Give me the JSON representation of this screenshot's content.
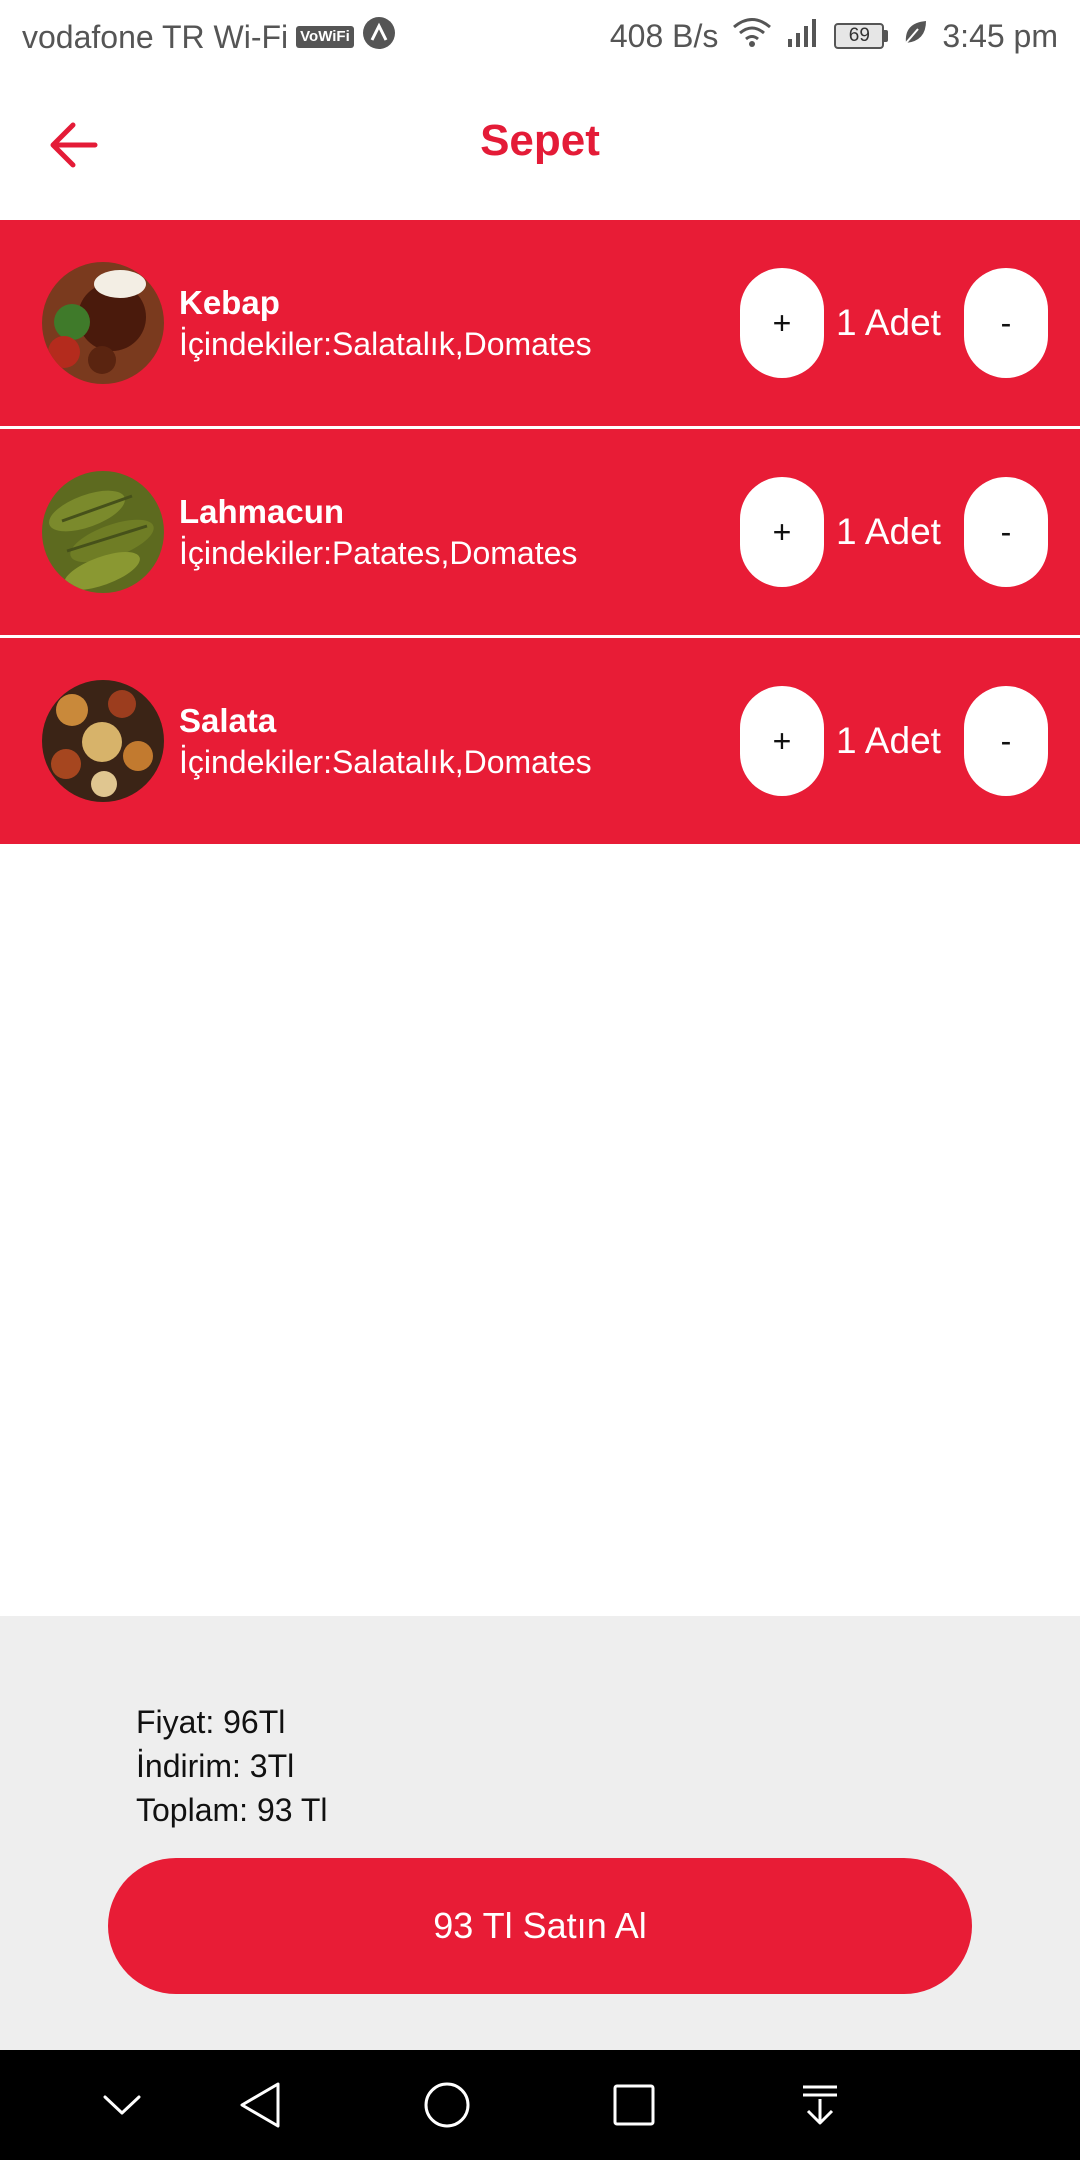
{
  "status_bar": {
    "carrier": "vodafone TR Wi-Fi",
    "vowifi_badge": "VoWiFi",
    "net_speed": "408 B/s",
    "battery_level": "69",
    "time": "3:45 pm"
  },
  "header": {
    "title": "Sepet",
    "accent_color": "#e41b37"
  },
  "cart": {
    "row_color": "#e81c36",
    "items": [
      {
        "name": "Kebap",
        "ingredients": "İçindekiler:Salatalık,Domates",
        "quantity_label": "1 Adet",
        "plus_label": "+",
        "minus_label": "-"
      },
      {
        "name": "Lahmacun",
        "ingredients": "İçindekiler:Patates,Domates",
        "quantity_label": "1 Adet",
        "plus_label": "+",
        "minus_label": "-"
      },
      {
        "name": "Salata",
        "ingredients": "İçindekiler:Salatalık,Domates",
        "quantity_label": "1 Adet",
        "plus_label": "+",
        "minus_label": "-"
      }
    ]
  },
  "summary": {
    "price": "Fiyat: 96Tl",
    "discount": "İndirim: 3Tl",
    "total": "Toplam: 93 Tl",
    "buy_label": "93 Tl Satın Al"
  },
  "nav_bar": {
    "icons": [
      "chevron-down-icon",
      "back-triangle-icon",
      "home-circle-icon",
      "recents-square-icon",
      "notification-pull-icon"
    ]
  }
}
